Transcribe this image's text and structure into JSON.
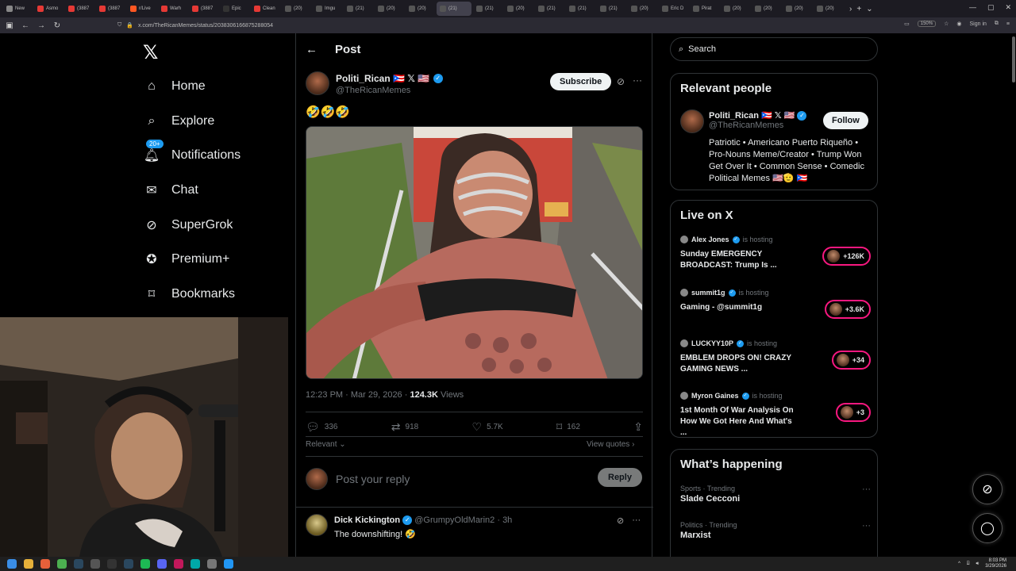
{
  "browser": {
    "tabs": [
      "New",
      "Asmo",
      "(3887",
      "(3887",
      "r/Live",
      "Warh",
      "(3887",
      "Epic",
      "Clean",
      "(20)",
      "Imgu",
      "(21)",
      "(20)",
      "(20)",
      "(21)",
      "(21)",
      "(20)",
      "(21)",
      "(21)",
      "(21)",
      "(20)",
      "Eric D",
      "Pirat",
      "(20)",
      "(20)",
      "(20)",
      "(20)"
    ],
    "active_tab": "(21)",
    "url": "x.com/TheRicanMemes/status/2038306166875288054",
    "zoom": "150%",
    "signin": "Sign in"
  },
  "nav": {
    "logo": "𝕏",
    "items": [
      {
        "label": "Home",
        "icon": "home-icon"
      },
      {
        "label": "Explore",
        "icon": "search-icon"
      },
      {
        "label": "Notifications",
        "icon": "bell-icon",
        "badge": "20+"
      },
      {
        "label": "Chat",
        "icon": "mail-icon"
      },
      {
        "label": "SuperGrok",
        "icon": "grok-icon"
      },
      {
        "label": "Premium+",
        "icon": "verified-icon"
      },
      {
        "label": "Bookmarks",
        "icon": "bookmark-icon"
      }
    ]
  },
  "post": {
    "header": "Post",
    "author_name": "Politi_Rican 🇵🇷 𝕏 🇺🇸",
    "author_handle": "@TheRicanMemes",
    "subscribe_label": "Subscribe",
    "text": "🤣🤣🤣",
    "time": "12:23 PM · Mar 29, 2026 · ",
    "views_count": "124.3K",
    "views_label": " Views",
    "replies": "336",
    "reposts": "918",
    "likes": "5.7K",
    "bookmarks": "162",
    "sort_label": "Relevant",
    "view_quotes": "View quotes",
    "reply_placeholder": "Post your reply",
    "reply_button": "Reply"
  },
  "comment": {
    "name": "Dick Kickington",
    "handle": "@GrumpyOldMarin2",
    "time": "· 3h",
    "text": "The downshifting! 🤣"
  },
  "right": {
    "search_placeholder": "Search",
    "relevant_title": "Relevant people",
    "rp_name": "Politi_Rican 🇵🇷 𝕏 🇺🇸",
    "rp_handle": "@TheRicanMemes",
    "follow_label": "Follow",
    "rp_bio": "Patriotic • Americano Puerto Riqueño • Pro-Nouns Meme/Creator • Trump Won Get Over It • Common Sense • Comedic Political Memes 🇺🇸🫡 🇵🇷",
    "live_title": "Live on X",
    "live": [
      {
        "host": "Alex Jones",
        "status": "is hosting",
        "title": "Sunday EMERGENCY BROADCAST: Trump Is ...",
        "count": "+126K"
      },
      {
        "host": "summit1g",
        "status": "is hosting",
        "title": "Gaming - @summit1g",
        "count": "+3.6K"
      },
      {
        "host": "LUCKYY10P",
        "status": "is hosting",
        "title": "EMBLEM DROPS ON! CRAZY GAMING NEWS ...",
        "count": "+34"
      },
      {
        "host": "Myron Gaines",
        "status": "is hosting",
        "title": "1st Month Of War Analysis On How We Got Here And What's ...",
        "count": "+3"
      }
    ],
    "happening_title": "What’s happening",
    "trends": [
      {
        "category": "Sports · Trending",
        "topic": "Slade Cecconi"
      },
      {
        "category": "Politics · Trending",
        "topic": "Marxist"
      }
    ]
  },
  "taskbar": {
    "time": "8:03 PM",
    "date": "3/29/2026"
  },
  "colors": {
    "accent": "#1d9bf0",
    "live_ring": "#f91880",
    "background": "#000000"
  }
}
